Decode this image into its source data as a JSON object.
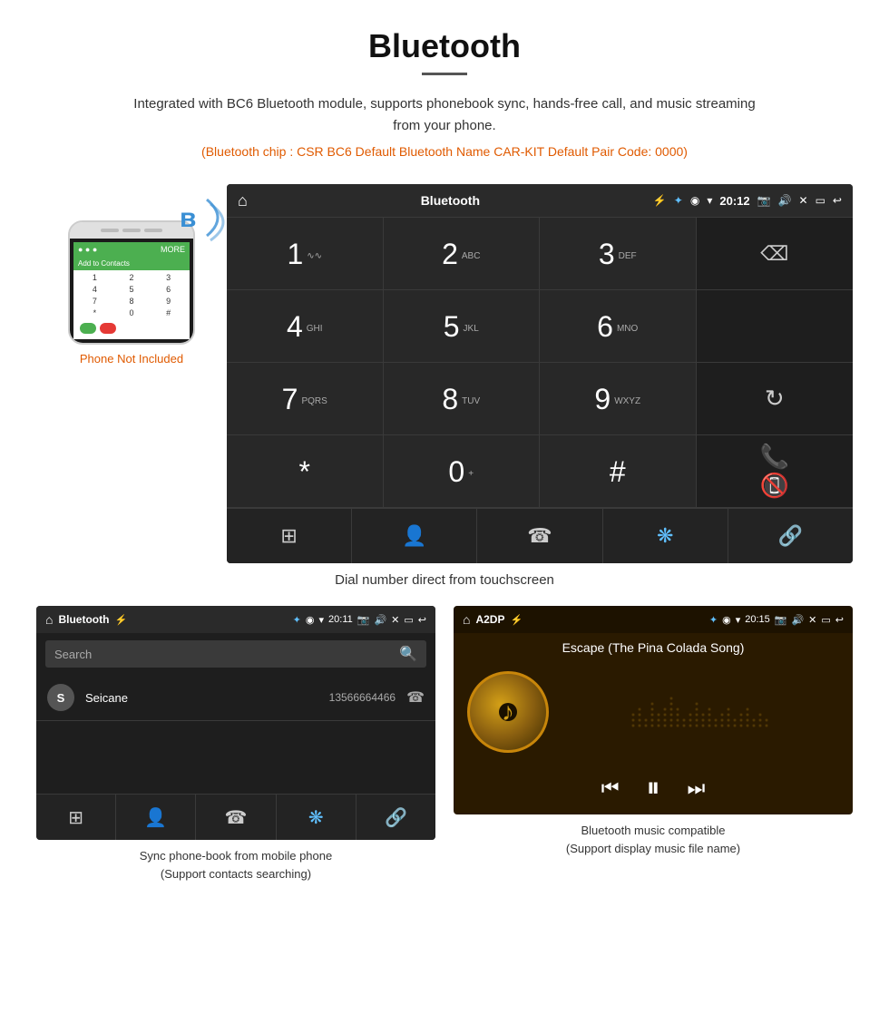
{
  "page": {
    "title": "Bluetooth",
    "description": "Integrated with BC6 Bluetooth module, supports phonebook sync, hands-free call, and music streaming from your phone.",
    "specs": "(Bluetooth chip : CSR BC6    Default Bluetooth Name CAR-KIT    Default Pair Code: 0000)"
  },
  "dial_screen": {
    "status_bar": {
      "title": "Bluetooth",
      "time": "20:12",
      "usb_symbol": "⚡"
    },
    "dialpad": [
      {
        "digit": "1",
        "letters": "∿∿"
      },
      {
        "digit": "2",
        "letters": "ABC"
      },
      {
        "digit": "3",
        "letters": "DEF"
      },
      {
        "digit": "",
        "letters": ""
      },
      {
        "digit": "4",
        "letters": "GHI"
      },
      {
        "digit": "5",
        "letters": "JKL"
      },
      {
        "digit": "6",
        "letters": "MNO"
      },
      {
        "digit": "",
        "letters": ""
      },
      {
        "digit": "7",
        "letters": "PQRS"
      },
      {
        "digit": "8",
        "letters": "TUV"
      },
      {
        "digit": "9",
        "letters": "WXYZ"
      },
      {
        "digit": "",
        "letters": ""
      },
      {
        "digit": "*",
        "letters": ""
      },
      {
        "digit": "0",
        "letters": "+"
      },
      {
        "digit": "#",
        "letters": ""
      },
      {
        "digit": "",
        "letters": ""
      }
    ],
    "caption": "Dial number direct from touchscreen"
  },
  "phone_image": {
    "not_included_text": "Phone Not Included"
  },
  "phonebook_screen": {
    "status_bar_title": "Bluetooth",
    "search_placeholder": "Search",
    "contacts": [
      {
        "initial": "S",
        "name": "Seicane",
        "number": "13566664466"
      }
    ],
    "caption_line1": "Sync phone-book from mobile phone",
    "caption_line2": "(Support contacts searching)"
  },
  "music_screen": {
    "status_bar_title": "A2DP",
    "time": "20:15",
    "song_name": "Escape (The Pina Colada Song)",
    "caption_line1": "Bluetooth music compatible",
    "caption_line2": "(Support display music file name)"
  }
}
